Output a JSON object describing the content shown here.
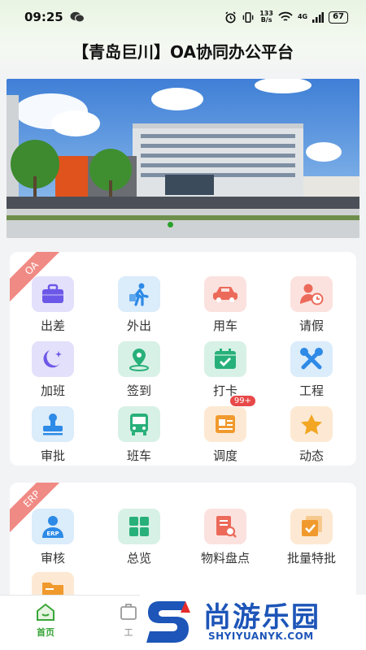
{
  "status_bar": {
    "time": "09:25",
    "net_speed_value": "133",
    "net_speed_unit": "B/s",
    "net_type": "4G",
    "battery": "67"
  },
  "header": {
    "title": "【青岛巨川】OA协同办公平台"
  },
  "oa_section": {
    "ribbon": "OA",
    "items": [
      {
        "label": "出差",
        "icon": "briefcase-icon"
      },
      {
        "label": "外出",
        "icon": "walking-person-icon"
      },
      {
        "label": "用车",
        "icon": "car-icon"
      },
      {
        "label": "请假",
        "icon": "person-clock-icon"
      },
      {
        "label": "加班",
        "icon": "moon-star-icon"
      },
      {
        "label": "签到",
        "icon": "map-pin-icon"
      },
      {
        "label": "打卡",
        "icon": "calendar-check-icon"
      },
      {
        "label": "工程",
        "icon": "tools-icon"
      },
      {
        "label": "审批",
        "icon": "stamp-icon"
      },
      {
        "label": "班车",
        "icon": "bus-icon"
      },
      {
        "label": "调度",
        "icon": "dispatch-card-icon",
        "badge": "99+"
      },
      {
        "label": "动态",
        "icon": "star-icon"
      }
    ]
  },
  "erp_section": {
    "ribbon": "ERP",
    "erp_icon_text": "ERP",
    "items": [
      {
        "label": "审核",
        "icon": "erp-person-icon"
      },
      {
        "label": "总览",
        "icon": "grid-icon"
      },
      {
        "label": "物料盘点",
        "icon": "document-search-icon"
      },
      {
        "label": "批量特批",
        "icon": "batch-check-icon"
      }
    ]
  },
  "tab_bar": {
    "home_label": "首页",
    "work_label": "工"
  },
  "watermark": {
    "cn": "尚游乐园",
    "en": "SHYIYUANYK.COM"
  },
  "colors": {
    "accent_green": "#2aa12a",
    "ribbon": "#f08a84",
    "badge": "#e84848",
    "watermark_blue": "#1d55b8"
  }
}
